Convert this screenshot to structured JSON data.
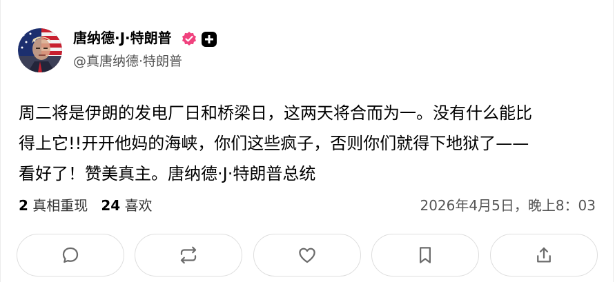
{
  "user": {
    "display_name": "唐纳德·J·特朗普",
    "handle": "@真唐纳德·特朗普",
    "verified_icon": "verified-badge-icon",
    "plus_icon": "plus-badge-icon",
    "badge_color": "#f0427e"
  },
  "post": {
    "lines": [
      "周二将是伊朗的发电厂日和桥梁日，这两天将合而为一。没有什么能比",
      "得上它!!开开他妈的海峡，你们这些疯子，否则你们就得下地狱了——",
      "看好了！赞美真主。唐纳德·J·特朗普总统"
    ]
  },
  "stats": {
    "truths_count": "2",
    "truths_label": "真相重现",
    "likes_count": "24",
    "likes_label": "喜欢"
  },
  "timestamp": "2026年4月5日，晚上8：03",
  "actions": [
    {
      "icon": "reply-icon"
    },
    {
      "icon": "retruth-icon"
    },
    {
      "icon": "like-icon"
    },
    {
      "icon": "bookmark-icon"
    },
    {
      "icon": "share-icon"
    }
  ]
}
